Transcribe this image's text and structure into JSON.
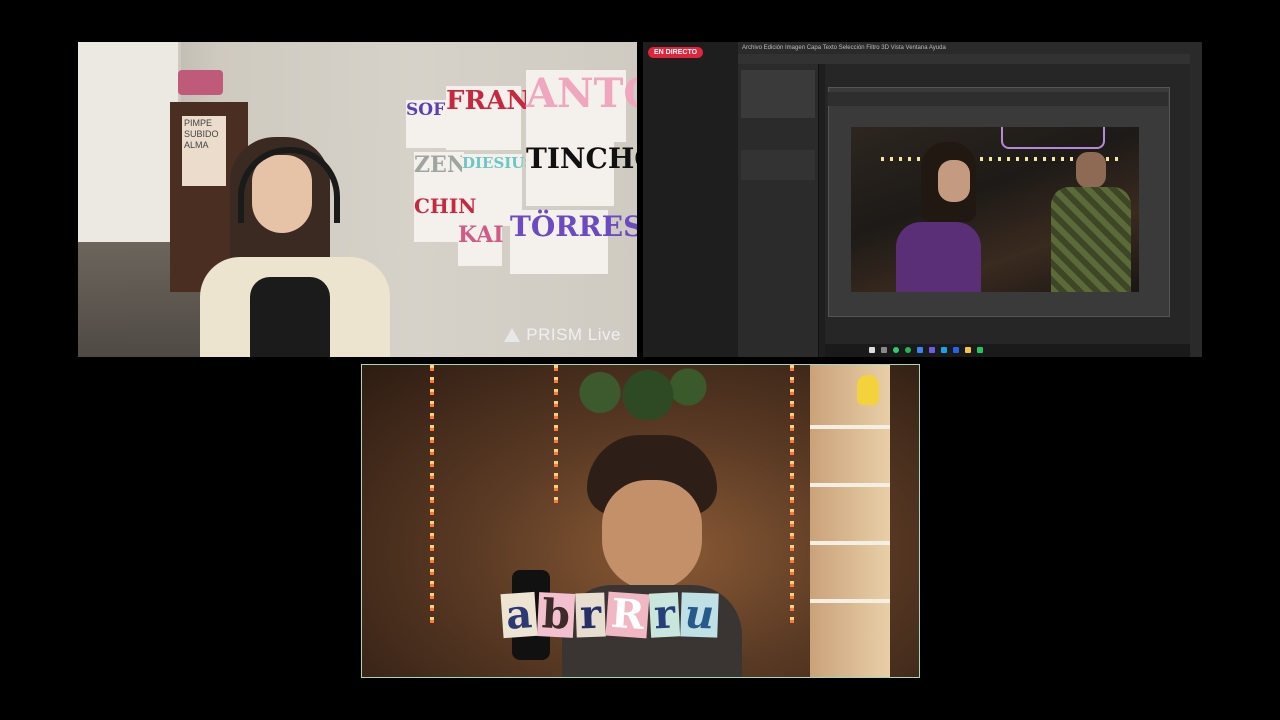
{
  "top_left": {
    "wall_papers": [
      {
        "text": "SOFI",
        "color": "#5a3fb5"
      },
      {
        "text": "FRANCO",
        "color": "#c8283f"
      },
      {
        "text": "ANTO",
        "color": "#f1a6bf"
      },
      {
        "text": "ZEN",
        "color": "#9fa6a2"
      },
      {
        "text": "DIESIUS",
        "color": "#6bc7c7"
      },
      {
        "text": "TINCHO",
        "color": "#111111"
      },
      {
        "text": "CHIN",
        "color": "#c8283f"
      },
      {
        "text": "KAI",
        "color": "#cf5b86"
      },
      {
        "text": "TÖRRES",
        "color": "#6b4ac2"
      }
    ],
    "shelf_sign": "PIMPE\nSUBIDO\nALMA",
    "watermark": "PRISM Live"
  },
  "top_right": {
    "live_badge": "EN DIRECTO",
    "ps_menu": "Archivo  Edición  Imagen  Capa  Texto  Selección  Filtro  3D  Vista  Ventana  Ayuda",
    "colors": {
      "badge": "#e0243b"
    }
  },
  "bottom": {
    "overlay_letters": [
      {
        "char": "a",
        "bg": "#eee4d2",
        "fg": "#2b3a74"
      },
      {
        "char": "b",
        "bg": "#f2c0cf",
        "fg": "#3d2a2a"
      },
      {
        "char": "r",
        "bg": "#e7ded0",
        "fg": "#253068"
      },
      {
        "char": "R",
        "bg": "#f1b7c3",
        "fg": "#ffffff"
      },
      {
        "char": "r",
        "bg": "#c9e6dc",
        "fg": "#283e7a"
      },
      {
        "char": "u",
        "bg": "#bfe1e6",
        "fg": "#275a8a"
      }
    ]
  }
}
